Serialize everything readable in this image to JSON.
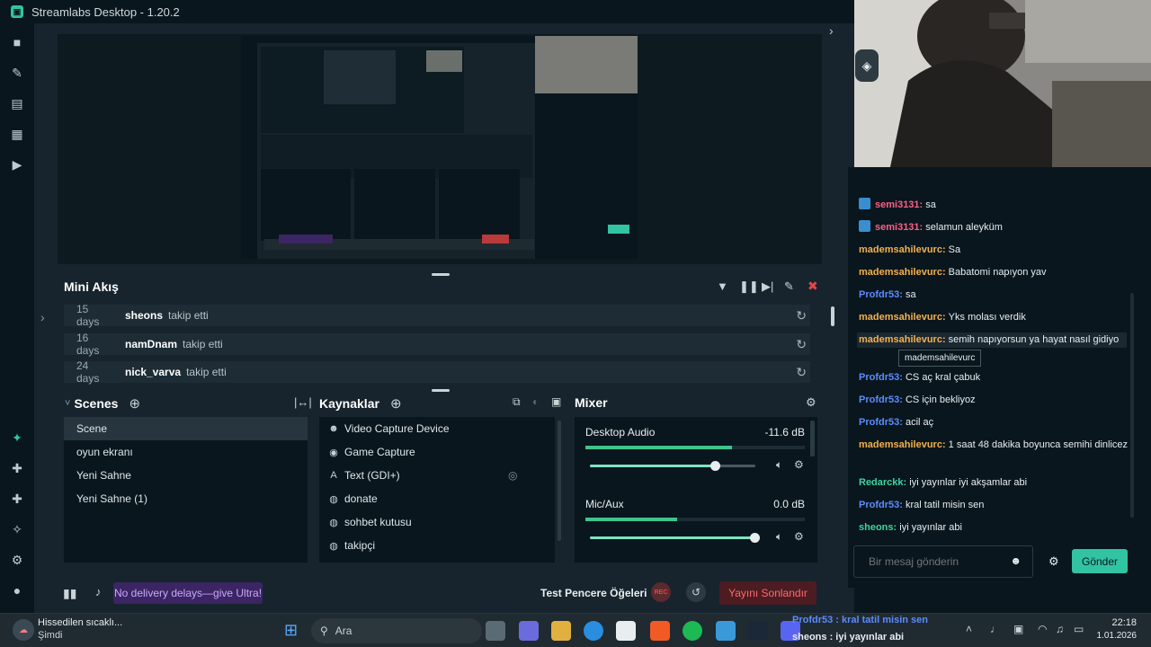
{
  "app": {
    "title": "Streamlabs Desktop - 1.20.2"
  },
  "nav": [
    "studio-icon",
    "themes-icon",
    "store-icon",
    "recordings-icon",
    "play-icon",
    "highlighter-icon",
    "integrations-icon",
    "collab-icon",
    "ai-icon",
    "settings-icon",
    "profile-icon"
  ],
  "mini_feed": {
    "title": "Mini Akış",
    "rows": [
      {
        "days": "15 days",
        "user": "sheons",
        "action": "takip etti"
      },
      {
        "days": "16 days",
        "user": "namDnam",
        "action": "takip etti"
      },
      {
        "days": "24 days",
        "user": "nick_varva",
        "action": "takip etti"
      }
    ]
  },
  "scenes": {
    "title": "Scenes",
    "items": [
      "Scene",
      "oyun ekranı",
      "Yeni Sahne",
      "Yeni Sahne (1)"
    ],
    "selected": "Scene"
  },
  "sources": {
    "title": "Kaynaklar",
    "items": [
      {
        "icon": "camera-icon",
        "label": "Video Capture Device"
      },
      {
        "icon": "gamepad-icon",
        "label": "Game Capture"
      },
      {
        "icon": "text-icon",
        "label": "Text (GDI+)"
      },
      {
        "icon": "globe-icon",
        "label": "donate"
      },
      {
        "icon": "globe-icon",
        "label": "sohbet kutusu"
      },
      {
        "icon": "globe-icon",
        "label": "takipçi"
      }
    ]
  },
  "mixer": {
    "title": "Mixer",
    "channels": [
      {
        "name": "Desktop Audio",
        "db": "-11.6 dB",
        "level": 0.67,
        "volume": 0.76
      },
      {
        "name": "Mic/Aux",
        "db": "0.0 dB",
        "level": 0.42,
        "volume": 1.0
      }
    ]
  },
  "footer": {
    "ultra": "No delivery delays—give Ultra!",
    "test_widgets": "Test Pencere Öğeleri",
    "rec": "REC",
    "end_stream": "Yayını Sonlandır"
  },
  "chat": {
    "messages": [
      {
        "user": "semi3131",
        "color": "#ff5f87",
        "text": "sa",
        "badge": true
      },
      {
        "user": "semi3131",
        "color": "#ff5f87",
        "text": "selamun aleyküm",
        "badge": true
      },
      {
        "user": "mademsahilevurc",
        "color": "#f4b04f",
        "text": "Sa"
      },
      {
        "user": "mademsahilevurc",
        "color": "#f4b04f",
        "text": "Babatomi napıyon yav"
      },
      {
        "user": "Profdr53",
        "color": "#5b8cff",
        "text": "sa"
      },
      {
        "user": "mademsahilevurc",
        "color": "#f4b04f",
        "text": "Yks molası verdik"
      },
      {
        "user": "mademsahilevurc",
        "color": "#f4b04f",
        "text": "semih napıyorsun ya hayat nasıl gidiyo"
      },
      {
        "user": "Profdr53",
        "color": "#5b8cff",
        "text": "CS aç kral çabuk"
      },
      {
        "user": "Profdr53",
        "color": "#5b8cff",
        "text": "CS için bekliyoz"
      },
      {
        "user": "Profdr53",
        "color": "#5b8cff",
        "text": "acil aç"
      },
      {
        "user": "mademsahilevurc",
        "color": "#f4b04f",
        "text": "1 saat 48 dakika boyunca semihi dinlicez"
      },
      {
        "user": "Redarckk",
        "color": "#3ed3a1",
        "text": "iyi yayınlar iyi akşamlar abi"
      },
      {
        "user": "Profdr53",
        "color": "#5b8cff",
        "text": "kral tatil misin sen"
      },
      {
        "user": "sheons",
        "color": "#3ed3a1",
        "text": "iyi yayınlar abi"
      }
    ],
    "tooltip": "mademsahilevurc",
    "placeholder": "Bir mesaj gönderin",
    "send": "Gönder"
  },
  "taskbar": {
    "weather_title": "Hissedilen sıcaklı...",
    "weather_sub": "Şimdi",
    "search": "Ara",
    "overlay_line1": "Profdr53 : kral tatil misin sen",
    "overlay_line2": "sheons : iyi yayınlar abi",
    "time": "22:18",
    "date": "1.01.2026"
  }
}
